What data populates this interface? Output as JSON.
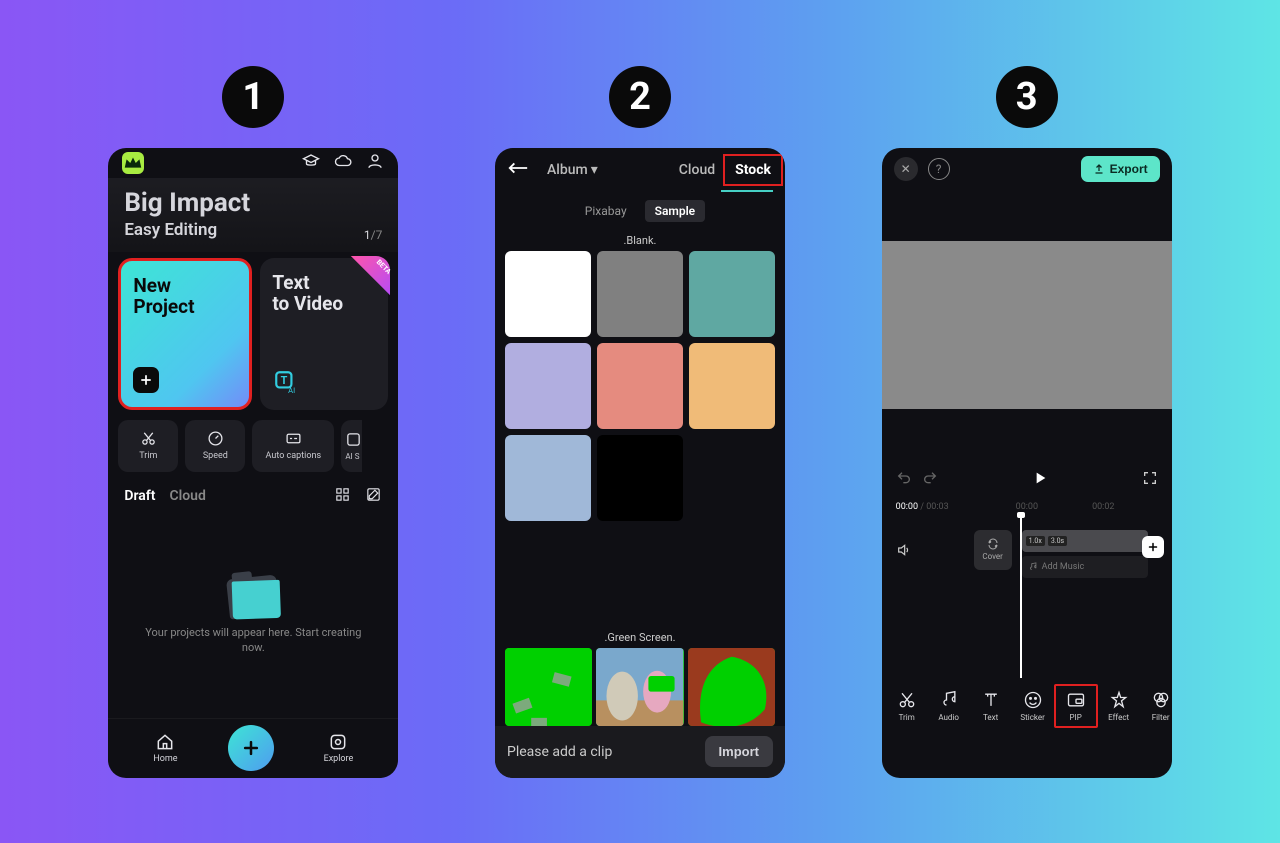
{
  "steps": [
    "1",
    "2",
    "3"
  ],
  "phone1": {
    "hero": {
      "title": "Big Impact",
      "subtitle": "Easy Editing",
      "pager_current": "1",
      "pager_total": "/7"
    },
    "cards": {
      "new_project": "New\nProject",
      "text_to_video": "Text\nto Video",
      "beta_label": "BETA"
    },
    "tools": [
      "Trim",
      "Speed",
      "Auto captions",
      "AI S"
    ],
    "tabs": {
      "draft": "Draft",
      "cloud": "Cloud"
    },
    "empty_text": "Your projects will appear here. Start creating now.",
    "nav": {
      "home": "Home",
      "explore": "Explore"
    }
  },
  "phone2": {
    "top_tabs": {
      "album": "Album",
      "cloud": "Cloud",
      "stock": "Stock"
    },
    "sub_tabs": {
      "pixabay": "Pixabay",
      "sample": "Sample"
    },
    "sections": {
      "blank": ".Blank.",
      "green_screen": ".Green Screen."
    },
    "swatches": [
      "#ffffff",
      "#808080",
      "#5fa8a2",
      "#b1aee0",
      "#e58b7f",
      "#f0bb78",
      "#a0b8d8",
      "#000000"
    ],
    "prompt": "Please add a clip",
    "import_label": "Import"
  },
  "phone3": {
    "export_label": "Export",
    "time": {
      "current": "00:00",
      "total": " / 00:03",
      "t0": "00:00",
      "t1": "00:02"
    },
    "cover_label": "Cover",
    "clip_badges": [
      "1.0x",
      "3.0s"
    ],
    "add_music": "Add Music",
    "tools": [
      "Trim",
      "Audio",
      "Text",
      "Sticker",
      "PIP",
      "Effect",
      "Filter"
    ]
  }
}
